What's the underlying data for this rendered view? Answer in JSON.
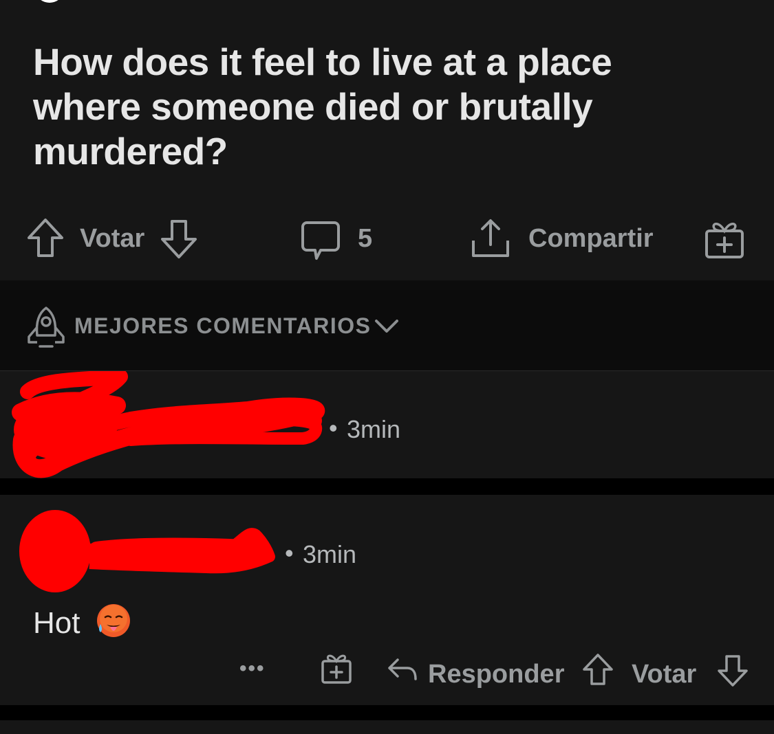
{
  "post": {
    "title": "How does it feel to live at a place where someone died or brutally murdered?",
    "vote_label": "Votar",
    "comment_count": "5",
    "share_label": "Compartir"
  },
  "sort": {
    "label": "MEJORES COMENTARIOS"
  },
  "comments": [
    {
      "time": "3min",
      "body": ""
    },
    {
      "time": "3min",
      "body": "Hot",
      "emoji": "hot-face-emoji",
      "more_label": "•••",
      "reply_label": "Responder",
      "vote_label": "Votar"
    }
  ],
  "colors": {
    "background": "#161616",
    "sort_background": "#0c0c0c",
    "text_primary": "#e6e6e6",
    "text_secondary": "#9a9d9f",
    "redaction": "#ff0000"
  }
}
